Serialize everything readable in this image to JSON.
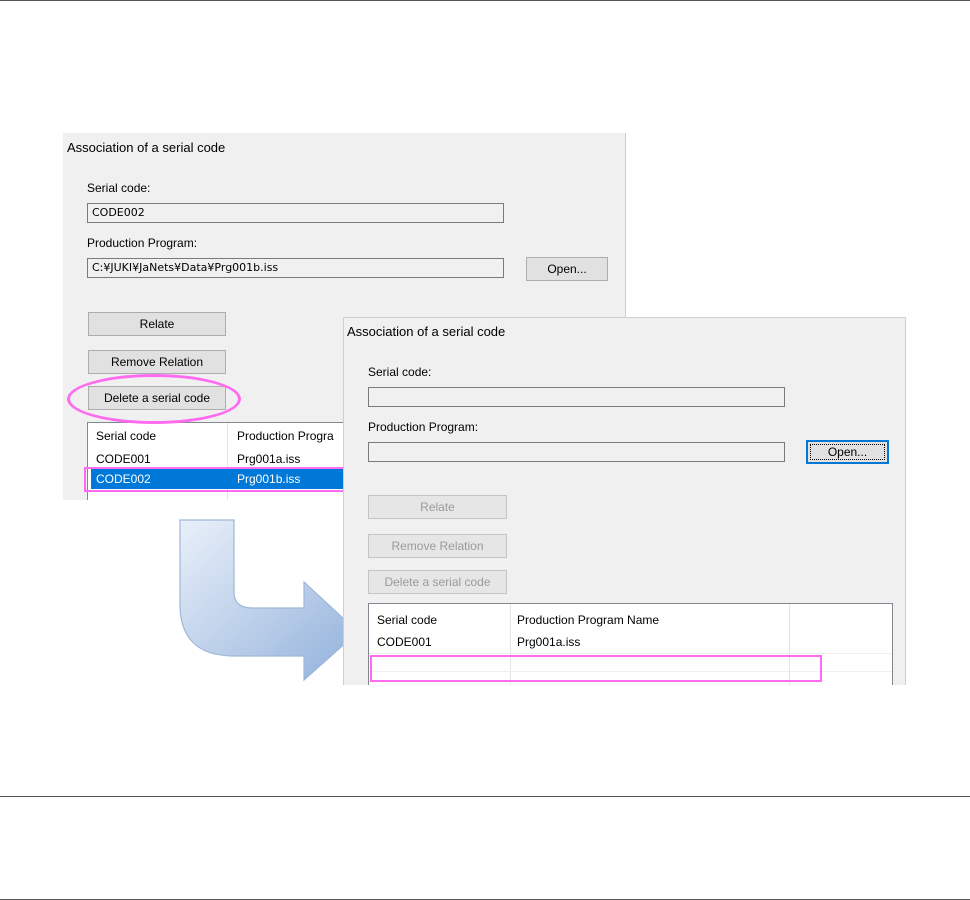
{
  "dialog_before": {
    "title": "Association of a serial code",
    "serial_label": "Serial code:",
    "serial_value": "CODE002",
    "program_label": "Production Program:",
    "program_value": "C:¥JUKI¥JaNets¥Data¥Prg001b.iss",
    "open_button": "Open...",
    "relate_button": "Relate",
    "remove_button": "Remove Relation",
    "delete_button": "Delete a serial code",
    "list": {
      "columns": [
        "Serial code",
        "Production Progra"
      ],
      "rows": [
        [
          "CODE001",
          "Prg001a.iss"
        ],
        [
          "CODE002",
          "Prg001b.iss"
        ]
      ]
    }
  },
  "dialog_after": {
    "title": "Association of a serial code",
    "serial_label": "Serial code:",
    "serial_value": "",
    "program_label": "Production Program:",
    "program_value": "",
    "open_button": "Open...",
    "relate_button": "Relate",
    "remove_button": "Remove Relation",
    "delete_button": "Delete a serial code",
    "list": {
      "columns": [
        "Serial code",
        "Production Program Name"
      ],
      "rows": [
        [
          "CODE001",
          "Prg001a.iss"
        ]
      ]
    }
  },
  "colors": {
    "highlight": "#ff6bf0",
    "selection": "#0078d7",
    "arrow": "#b9cde8"
  }
}
